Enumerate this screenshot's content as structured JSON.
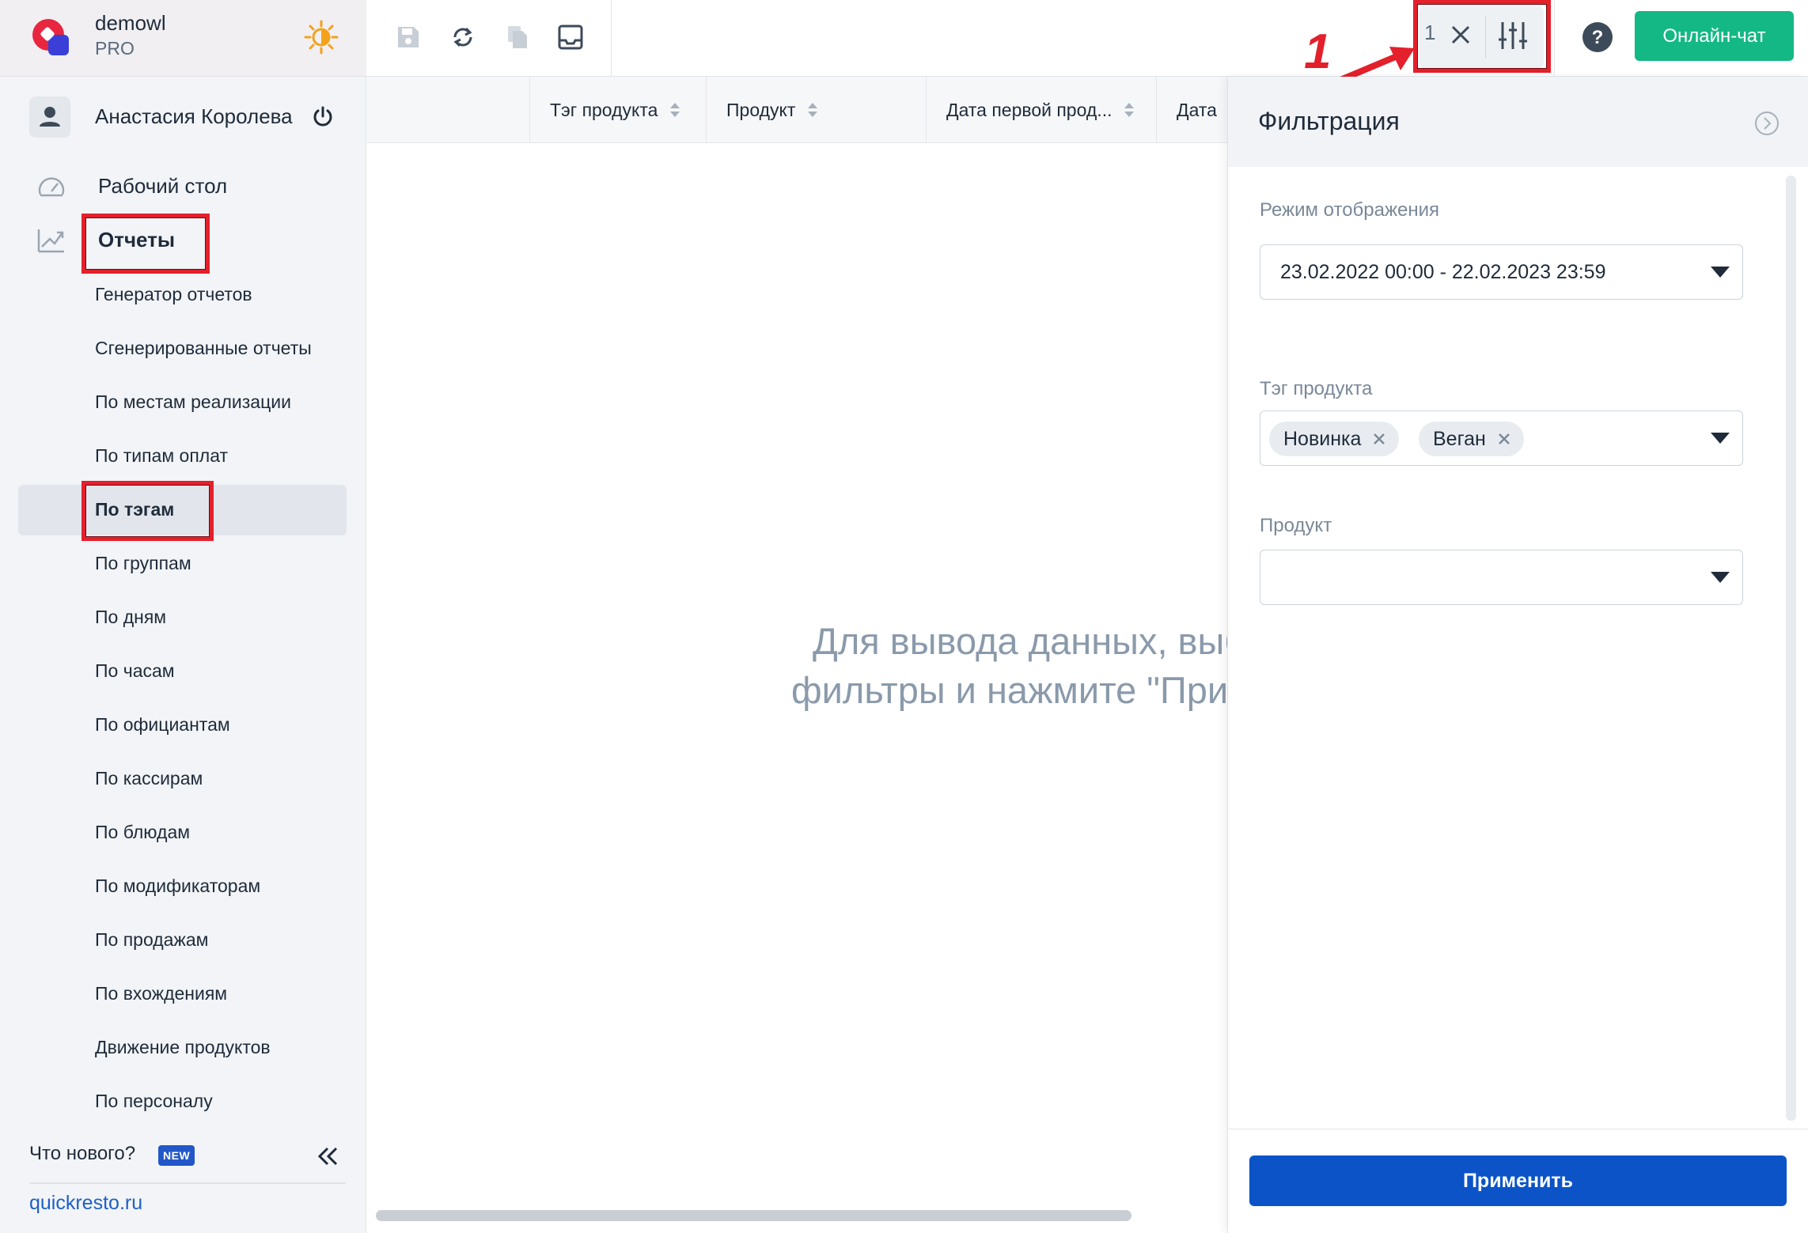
{
  "brand": {
    "name": "demowl",
    "plan": "PRO"
  },
  "user": {
    "name": "Анастасия Королева"
  },
  "nav": {
    "desktop": "Рабочий стол",
    "reports": "Отчеты",
    "subitems": [
      "Генератор отчетов",
      "Сгенерированные отчеты",
      "По местам реализации",
      "По типам оплат",
      "По тэгам",
      "По группам",
      "По дням",
      "По часам",
      "По официантам",
      "По кассирам",
      "По блюдам",
      "По модификаторам",
      "По продажам",
      "По вхождениям",
      "Движение продуктов",
      "По персоналу"
    ],
    "active_subitem": "По тэгам"
  },
  "footer": {
    "whats_new": "Что нового?",
    "new_badge": "NEW",
    "site": "quickresto.ru"
  },
  "toolbar": {
    "filter_count": "1",
    "chat_button": "Онлайн-чат",
    "annotation_number": "1"
  },
  "table": {
    "columns": [
      "Тэг продукта",
      "Продукт",
      "Дата первой прод...",
      "Дата"
    ],
    "empty_line1": "Для вывода данных, выберите",
    "empty_line2": "фильтры и нажмите \"Применить\""
  },
  "filter_panel": {
    "title": "Фильтрация",
    "mode_label": "Режим отображения",
    "mode_value": "23.02.2022 00:00 - 22.02.2023 23:59",
    "tag_label": "Тэг продукта",
    "tags": [
      "Новинка",
      "Веган"
    ],
    "product_label": "Продукт",
    "product_value": "",
    "apply_button": "Применить"
  },
  "colors": {
    "accent_green": "#14b884",
    "apply_blue": "#0b53c7",
    "annotation_red": "#e3202b",
    "link_blue": "#1f5fc8"
  }
}
